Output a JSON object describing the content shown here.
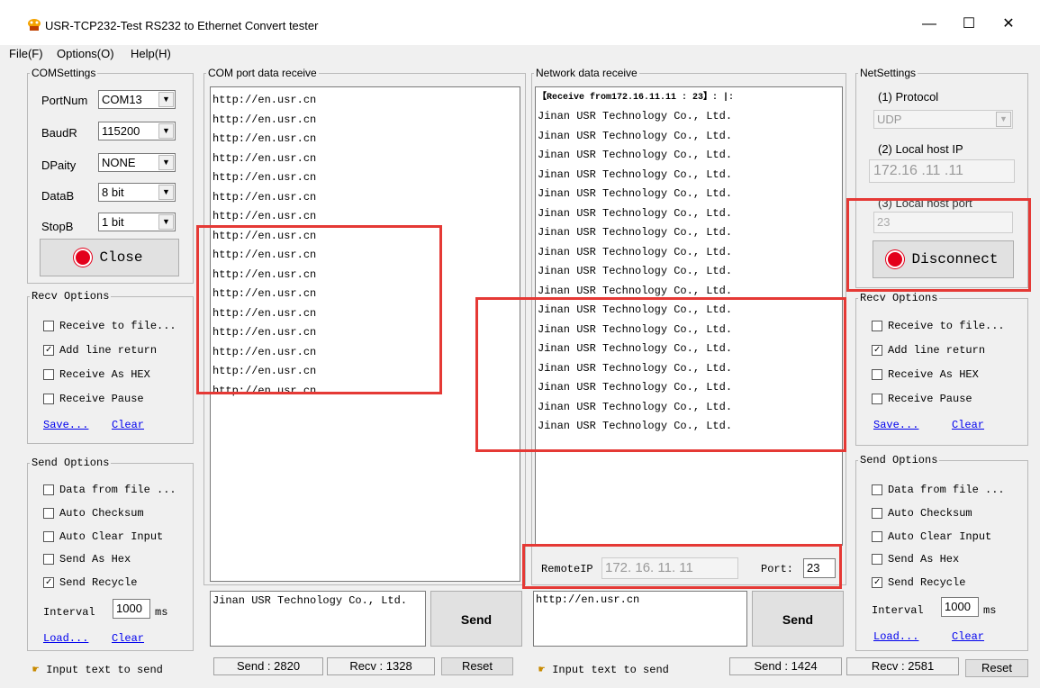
{
  "window": {
    "title": "USR-TCP232-Test  RS232 to Ethernet Convert tester",
    "minimize": "—",
    "maximize": "☐",
    "close": "✕"
  },
  "menu": [
    "File(F)",
    "Options(O)",
    "Help(H)"
  ],
  "com_settings": {
    "legend": "COMSettings",
    "fields": [
      {
        "label": "PortNum",
        "value": "COM13"
      },
      {
        "label": "BaudR",
        "value": "115200"
      },
      {
        "label": "DPaity",
        "value": "NONE"
      },
      {
        "label": "DataB",
        "value": "8 bit"
      },
      {
        "label": "StopB",
        "value": "1 bit"
      }
    ],
    "close_button": "Close"
  },
  "left_recv_options": {
    "legend": "Recv Options",
    "items": [
      {
        "label": "Receive to file...",
        "checked": false
      },
      {
        "label": "Add line return",
        "checked": true
      },
      {
        "label": "Receive As HEX",
        "checked": false
      },
      {
        "label": "Receive Pause",
        "checked": false
      }
    ],
    "save": "Save...",
    "clear": "Clear"
  },
  "left_send_options": {
    "legend": "Send Options",
    "items": [
      {
        "label": "Data from file ...",
        "checked": false
      },
      {
        "label": "Auto Checksum",
        "checked": false
      },
      {
        "label": "Auto Clear Input",
        "checked": false
      },
      {
        "label": "Send As Hex",
        "checked": false
      },
      {
        "label": "Send Recycle",
        "checked": true
      }
    ],
    "interval_label": "Interval",
    "interval_value": "1000",
    "interval_unit": "ms",
    "load": "Load...",
    "clear": "Clear"
  },
  "com_receive": {
    "legend": "COM port data receive",
    "lines": [
      "http://en.usr.cn",
      "http://en.usr.cn",
      "http://en.usr.cn",
      "http://en.usr.cn",
      "http://en.usr.cn",
      "http://en.usr.cn",
      "http://en.usr.cn",
      "http://en.usr.cn",
      "http://en.usr.cn",
      "http://en.usr.cn",
      "http://en.usr.cn",
      "http://en.usr.cn",
      "http://en.usr.cn",
      "http://en.usr.cn",
      "http://en.usr.cn",
      "http://en.usr.cn"
    ]
  },
  "com_send": {
    "text": "Jinan USR Technology Co., Ltd.",
    "send": "Send"
  },
  "net_receive": {
    "legend": "Network data receive",
    "header": "【Receive from172.16.11.11 : 23】:   |:",
    "lines": [
      "Jinan USR Technology Co., Ltd.",
      "Jinan USR Technology Co., Ltd.",
      "Jinan USR Technology Co., Ltd.",
      "Jinan USR Technology Co., Ltd.",
      "Jinan USR Technology Co., Ltd.",
      "Jinan USR Technology Co., Ltd.",
      "Jinan USR Technology Co., Ltd.",
      "Jinan USR Technology Co., Ltd.",
      "Jinan USR Technology Co., Ltd.",
      "Jinan USR Technology Co., Ltd.",
      "Jinan USR Technology Co., Ltd.",
      "Jinan USR Technology Co., Ltd.",
      "Jinan USR Technology Co., Ltd.",
      "Jinan USR Technology Co., Ltd.",
      "Jinan USR Technology Co., Ltd.",
      "Jinan USR Technology Co., Ltd.",
      "Jinan USR Technology Co., Ltd."
    ],
    "remote_ip_label": "RemoteIP",
    "remote_ip_value": "172. 16. 11. 11",
    "port_label": "Port:",
    "port_value": "23"
  },
  "net_send": {
    "text": "http://en.usr.cn",
    "send": "Send"
  },
  "net_settings": {
    "legend": "NetSettings",
    "protocol_label": "(1) Protocol",
    "protocol_value": "UDP",
    "local_ip_label": "(2) Local host IP",
    "local_ip_value": "172.16 .11 .11",
    "local_port_label": "(3) Local host port",
    "local_port_value": "23",
    "disconnect_button": "Disconnect"
  },
  "right_recv_options": {
    "legend": "Recv Options",
    "items": [
      {
        "label": "Receive to file...",
        "checked": false
      },
      {
        "label": "Add line return",
        "checked": true
      },
      {
        "label": "Receive As HEX",
        "checked": false
      },
      {
        "label": "Receive Pause",
        "checked": false
      }
    ],
    "save": "Save...",
    "clear": "Clear"
  },
  "right_send_options": {
    "legend": "Send Options",
    "items": [
      {
        "label": "Data from file ...",
        "checked": false
      },
      {
        "label": "Auto Checksum",
        "checked": false
      },
      {
        "label": "Auto Clear Input",
        "checked": false
      },
      {
        "label": "Send As Hex",
        "checked": false
      },
      {
        "label": "Send Recycle",
        "checked": true
      }
    ],
    "interval_label": "Interval",
    "interval_value": "1000",
    "interval_unit": "ms",
    "load": "Load...",
    "clear": "Clear"
  },
  "status": {
    "left_hint": "Input text to send",
    "com_send": "Send : 2820",
    "com_recv": "Recv : 1328",
    "reset": "Reset",
    "right_hint": "Input text to send",
    "net_send": "Send : 1424",
    "net_recv": "Recv : 2581",
    "net_reset": "Reset"
  }
}
